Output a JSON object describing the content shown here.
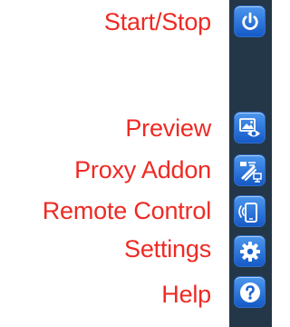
{
  "colors": {
    "label": "#ee2a24",
    "sidebar_bg": "#243749",
    "button_top": "#4c97ee",
    "button_bottom": "#1559c7"
  },
  "menu": {
    "start_stop": {
      "label": "Start/Stop",
      "icon": "power-icon"
    },
    "preview": {
      "label": "Preview",
      "icon": "preview-eye-icon"
    },
    "proxy_addon": {
      "label": "Proxy Addon",
      "icon": "proxy-addon-icon"
    },
    "remote_control": {
      "label": "Remote Control",
      "icon": "phone-remote-icon"
    },
    "settings": {
      "label": "Settings",
      "icon": "gear-icon"
    },
    "help": {
      "label": "Help",
      "icon": "question-icon"
    }
  }
}
